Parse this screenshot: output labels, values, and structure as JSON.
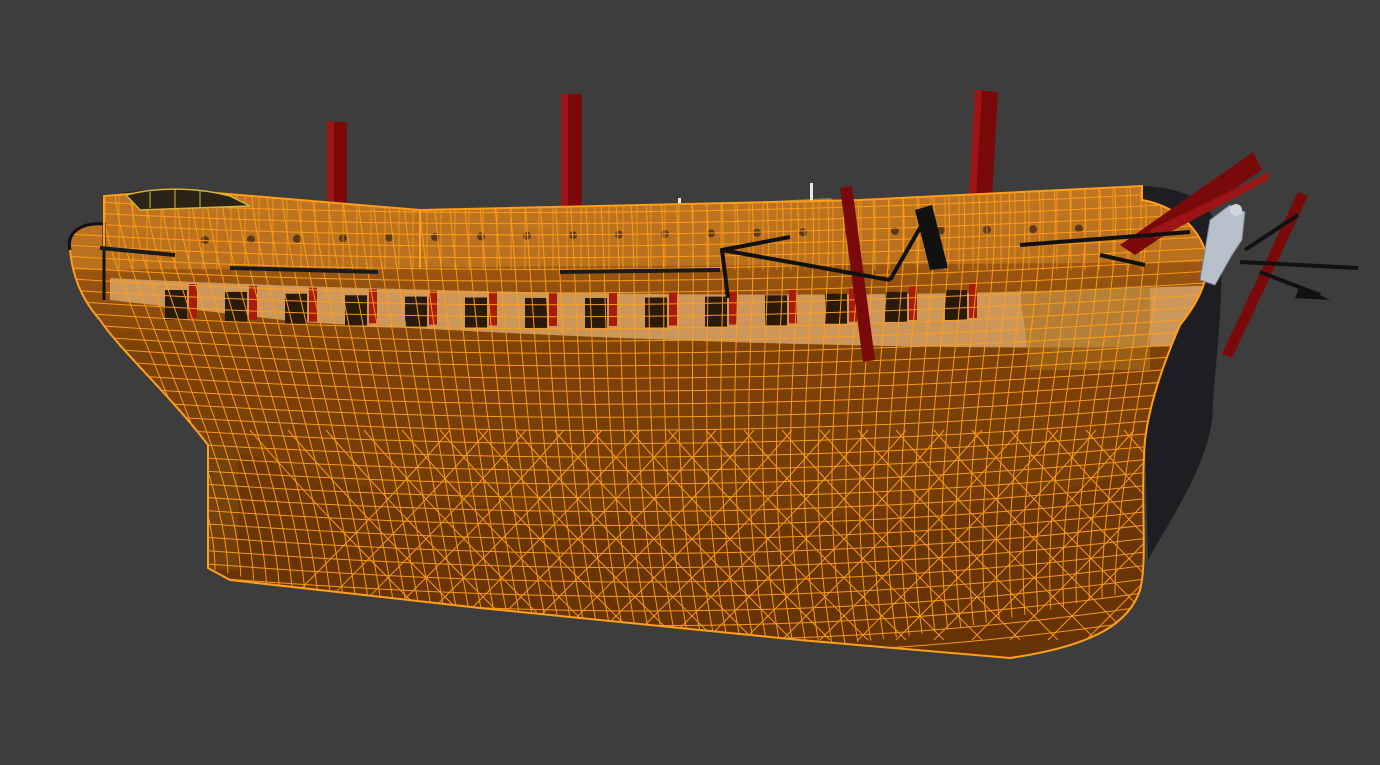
{
  "viewport": {
    "background": "#3d3d3d",
    "selection_color": "#ff9e1a",
    "hull_fill": "#8a4a08",
    "hull_fill_dark": "#5a2e06",
    "mast_color": "#7a0a0a",
    "rigging_color": "#111111",
    "figurehead_color": "#b8c0cc"
  },
  "scene": {
    "object": "ship-hull",
    "selected": true,
    "display_mode": "wireframe-on-shaded",
    "masts": 3,
    "gunports_visible": 14
  }
}
